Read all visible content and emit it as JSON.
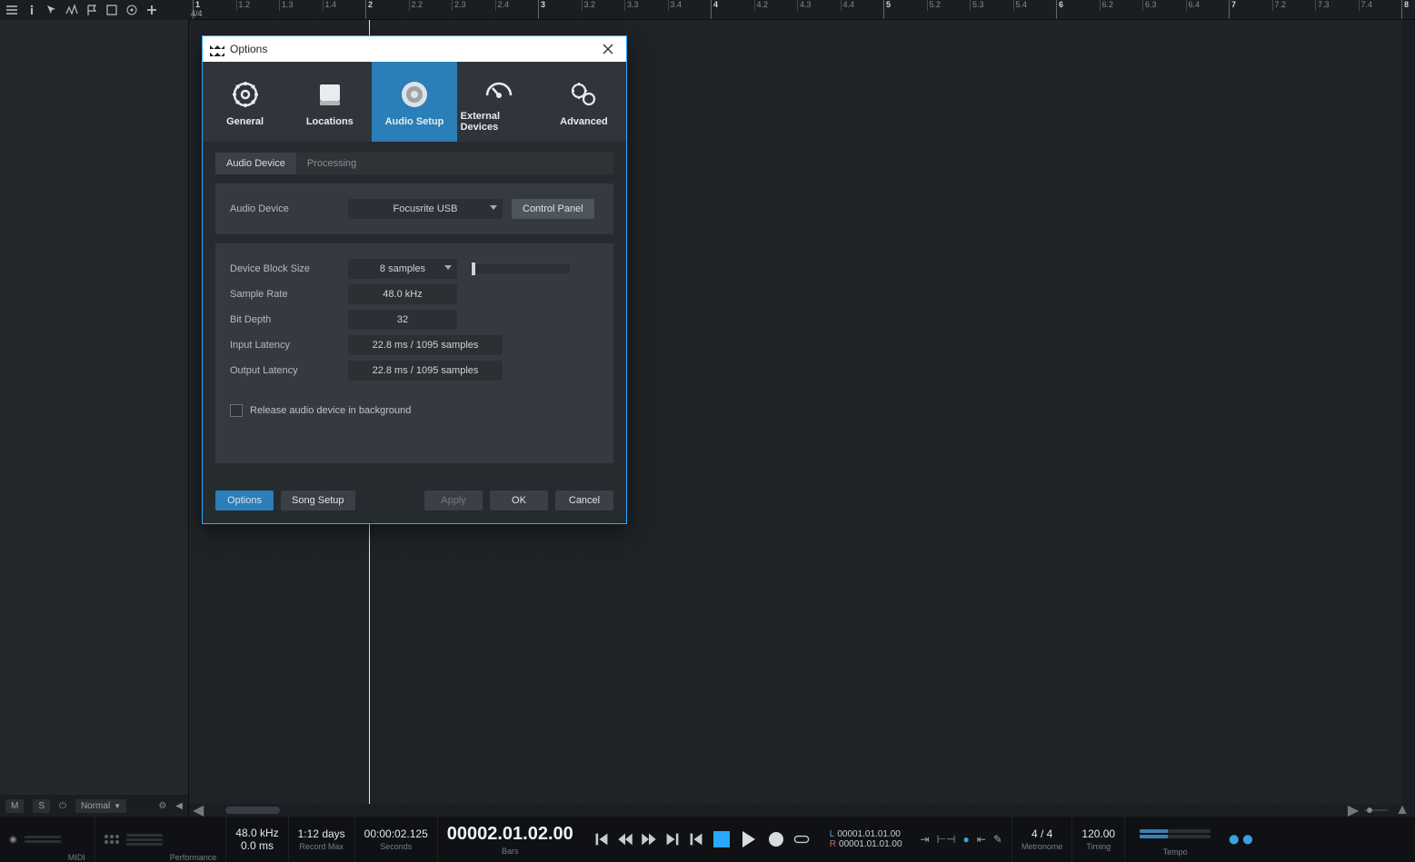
{
  "ruler": {
    "timesig": "4/4",
    "start_bar": 1,
    "bars": 7,
    "subdivisions": 4
  },
  "track_footer": {
    "m": "M",
    "s": "S",
    "mode": "Normal"
  },
  "transport": {
    "midi_label": "MIDI",
    "perf_label": "Performance",
    "sample_rate": "48.0 kHz",
    "dropout": "0.0 ms",
    "record_time": "1:12 days",
    "record_label": "Record Max",
    "seconds_time": "00:00:02.125",
    "seconds_label": "Seconds",
    "bars_time": "00002.01.02.00",
    "bars_label": "Bars",
    "loc_l_label": "L",
    "loc_l": "00001.01.01.00",
    "loc_r_label": "R",
    "loc_r": "00001.01.01.00",
    "timesig": "4 / 4",
    "tempo": "120.00",
    "metronome_label": "Metronome",
    "timing_label": "Timing",
    "tempo_label": "Tempo"
  },
  "dialog": {
    "title": "Options",
    "tabs": {
      "general": "General",
      "locations": "Locations",
      "audio": "Audio Setup",
      "external": "External Devices",
      "advanced": "Advanced"
    },
    "subtabs": {
      "device": "Audio Device",
      "processing": "Processing"
    },
    "labels": {
      "audio_device": "Audio Device",
      "control_panel": "Control Panel",
      "block_size": "Device Block Size",
      "sample_rate": "Sample Rate",
      "bit_depth": "Bit Depth",
      "input_latency": "Input Latency",
      "output_latency": "Output Latency",
      "release_bg": "Release audio device in background"
    },
    "values": {
      "audio_device": "Focusrite USB",
      "block_size": "8 samples",
      "sample_rate": "48.0 kHz",
      "bit_depth": "32",
      "input_latency": "22.8 ms / 1095 samples",
      "output_latency": "22.8 ms / 1095 samples"
    },
    "footer": {
      "options": "Options",
      "song_setup": "Song Setup",
      "apply": "Apply",
      "ok": "OK",
      "cancel": "Cancel"
    }
  }
}
